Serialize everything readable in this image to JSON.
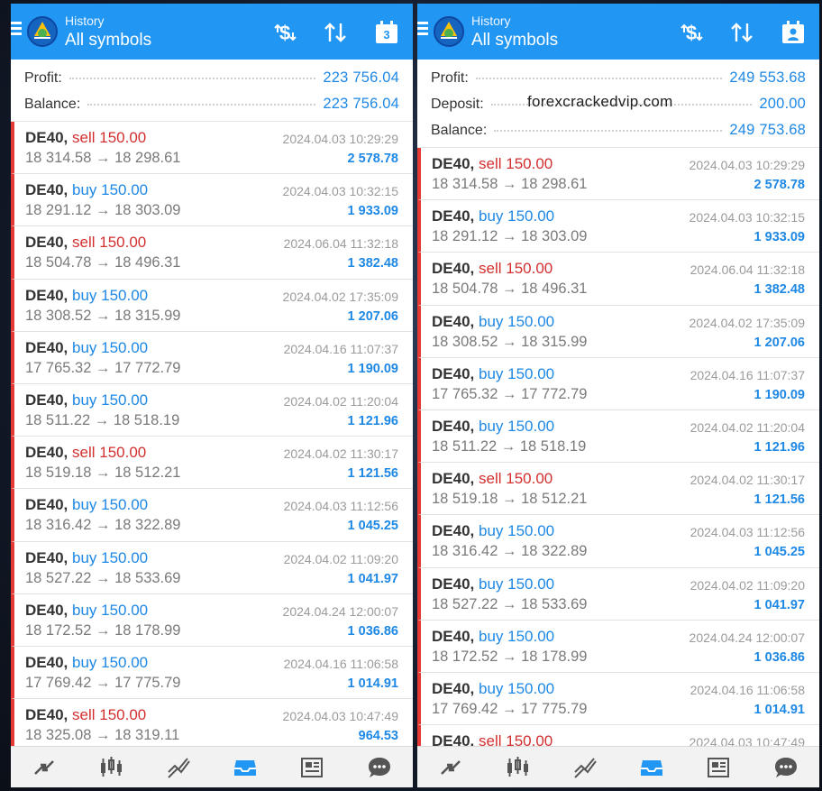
{
  "header": {
    "subtitle": "History",
    "title": "All symbols",
    "calendar_day": "3",
    "icons": [
      "menu-icon",
      "app-logo-icon",
      "dollar-exchange-icon",
      "sort-icon",
      "calendar-icon"
    ]
  },
  "left": {
    "summary": [
      {
        "label": "Profit:",
        "value": "223 756.04"
      },
      {
        "label": "Balance:",
        "value": "223 756.04"
      }
    ]
  },
  "right": {
    "summary": [
      {
        "label": "Profit:",
        "value": "249 553.68"
      },
      {
        "label": "Deposit:",
        "value": "200.00"
      },
      {
        "label": "Balance:",
        "value": "249 753.68"
      }
    ]
  },
  "watermark": "forexcrackedvip.com",
  "deals": [
    {
      "symbol": "DE40,",
      "side": "sell",
      "volume": "150.00",
      "open": "18 314.58",
      "close": "18 298.61",
      "time": "2024.04.03 10:29:29",
      "profit": "2 578.78"
    },
    {
      "symbol": "DE40,",
      "side": "buy",
      "volume": "150.00",
      "open": "18 291.12",
      "close": "18 303.09",
      "time": "2024.04.03 10:32:15",
      "profit": "1 933.09"
    },
    {
      "symbol": "DE40,",
      "side": "sell",
      "volume": "150.00",
      "open": "18 504.78",
      "close": "18 496.31",
      "time": "2024.06.04 11:32:18",
      "profit": "1 382.48"
    },
    {
      "symbol": "DE40,",
      "side": "buy",
      "volume": "150.00",
      "open": "18 308.52",
      "close": "18 315.99",
      "time": "2024.04.02 17:35:09",
      "profit": "1 207.06"
    },
    {
      "symbol": "DE40,",
      "side": "buy",
      "volume": "150.00",
      "open": "17 765.32",
      "close": "17 772.79",
      "time": "2024.04.16 11:07:37",
      "profit": "1 190.09"
    },
    {
      "symbol": "DE40,",
      "side": "buy",
      "volume": "150.00",
      "open": "18 511.22",
      "close": "18 518.19",
      "time": "2024.04.02 11:20:04",
      "profit": "1 121.96"
    },
    {
      "symbol": "DE40,",
      "side": "sell",
      "volume": "150.00",
      "open": "18 519.18",
      "close": "18 512.21",
      "time": "2024.04.02 11:30:17",
      "profit": "1 121.56"
    },
    {
      "symbol": "DE40,",
      "side": "buy",
      "volume": "150.00",
      "open": "18 316.42",
      "close": "18 322.89",
      "time": "2024.04.03 11:12:56",
      "profit": "1 045.25"
    },
    {
      "symbol": "DE40,",
      "side": "buy",
      "volume": "150.00",
      "open": "18 527.22",
      "close": "18 533.69",
      "time": "2024.04.02 11:09:20",
      "profit": "1 041.97"
    },
    {
      "symbol": "DE40,",
      "side": "buy",
      "volume": "150.00",
      "open": "18 172.52",
      "close": "18 178.99",
      "time": "2024.04.24 12:00:07",
      "profit": "1 036.86"
    },
    {
      "symbol": "DE40,",
      "side": "buy",
      "volume": "150.00",
      "open": "17 769.42",
      "close": "17 775.79",
      "time": "2024.04.16 11:06:58",
      "profit": "1 014.91"
    },
    {
      "symbol": "DE40,",
      "side": "sell",
      "volume": "150.00",
      "open": "18 325.08",
      "close": "18 319.11",
      "time": "2024.04.03 10:47:49",
      "profit": "964.53"
    }
  ],
  "bottom_nav": [
    "quotes-icon",
    "chart-icon",
    "trade-icon",
    "history-icon",
    "news-icon",
    "chat-icon"
  ],
  "colors": {
    "accent": "#2196f3",
    "sell": "#d32f2f",
    "buy": "#1e88e5",
    "stripe": "#e53935"
  }
}
